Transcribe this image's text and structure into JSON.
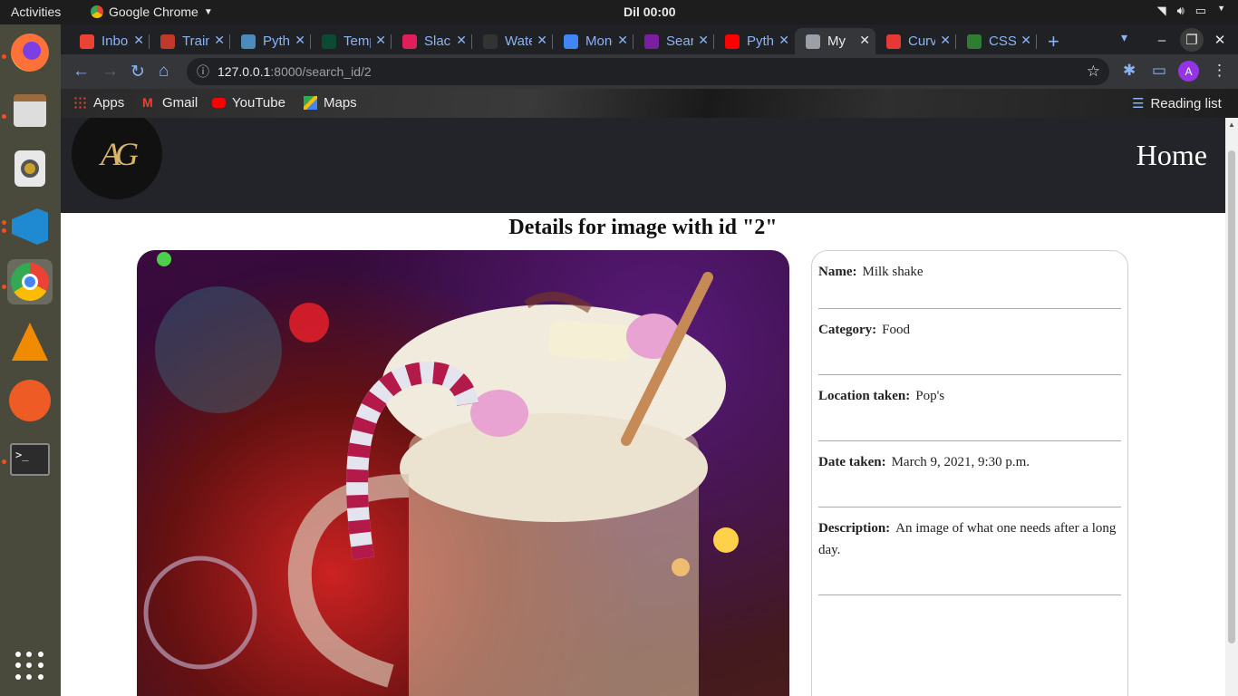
{
  "os": {
    "activities": "Activities",
    "app_name": "Google Chrome",
    "clock": "Dil 00:00"
  },
  "browser": {
    "tabs": [
      {
        "title": "Inbox",
        "favicon": "gmail-icon",
        "color": "#ea4335"
      },
      {
        "title": "Training",
        "favicon": "trello-icon",
        "color": "#c0392b"
      },
      {
        "title": "Python",
        "favicon": "python-icon",
        "color": "#4b8bbe"
      },
      {
        "title": "Templates",
        "favicon": "django-icon",
        "color": "#0c4b33"
      },
      {
        "title": "Slack",
        "favicon": "slack-icon",
        "color": "#e01e5a"
      },
      {
        "title": "Water",
        "favicon": "github-icon",
        "color": "#333333"
      },
      {
        "title": "Monday",
        "favicon": "google-docs-icon",
        "color": "#4285f4"
      },
      {
        "title": "Search",
        "favicon": "search-icon",
        "color": "#7b1fa2"
      },
      {
        "title": "Python",
        "favicon": "youtube-icon",
        "color": "#ff0000"
      },
      {
        "title": "My",
        "favicon": "globe-icon",
        "color": "#9aa0a6"
      },
      {
        "title": "Curve",
        "favicon": "asterisk-icon",
        "color": "#e53935"
      },
      {
        "title": "CSS",
        "favicon": "w-icon",
        "color": "#2e7d32"
      }
    ],
    "active_tab_index": 9,
    "url_host": "127.0.0.1",
    "url_path": ":8000/search_id/2",
    "profile_initial": "A",
    "bookmarks": [
      {
        "label": "Apps",
        "icon": "apps-grid-icon"
      },
      {
        "label": "Gmail",
        "icon": "gmail-icon"
      },
      {
        "label": "YouTube",
        "icon": "youtube-icon"
      },
      {
        "label": "Maps",
        "icon": "maps-icon"
      }
    ],
    "reading_list": "Reading list"
  },
  "site": {
    "logo_text": "AG",
    "nav_home": "Home",
    "heading": "Details for image with id \"2\"",
    "image_alt": "Milk shake",
    "details": [
      {
        "label": "Name:",
        "value": "Milk shake"
      },
      {
        "label": "Category:",
        "value": "Food"
      },
      {
        "label": "Location taken:",
        "value": "Pop's"
      },
      {
        "label": "Date taken:",
        "value": "March 9, 2021, 9:30 p.m."
      },
      {
        "label": "Description:",
        "value": "An image of what one needs after a long day."
      }
    ]
  },
  "colors": {
    "nav_bg": "#222429",
    "logo_gold": "#d9b56a",
    "chrome_accent": "#8ab4f8"
  }
}
